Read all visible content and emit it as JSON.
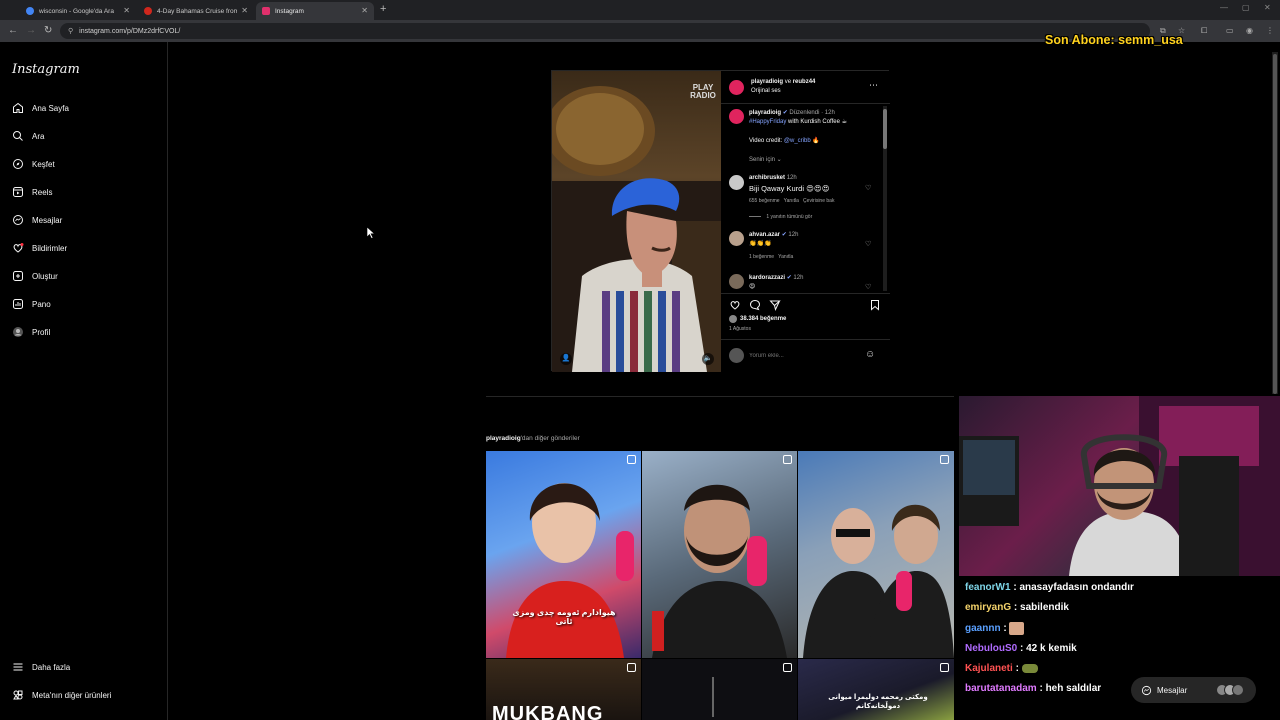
{
  "browser": {
    "tabs": [
      {
        "label": "wisconsin - Google'da Ara",
        "favicon_color": "#4285f4"
      },
      {
        "label": "4-Day Bahamas Cruise from Mi",
        "favicon_color": "#d0271d"
      },
      {
        "label": "Instagram",
        "favicon_color": "#e1306c"
      }
    ],
    "url": "instagram.com/p/DMz2drfCVOL/"
  },
  "overlay": {
    "subscriber": "Son Abone: semm_usa"
  },
  "sidebar": {
    "logo": "Instagram",
    "items": [
      {
        "label": "Ana Sayfa",
        "icon": "home-icon"
      },
      {
        "label": "Ara",
        "icon": "search-icon"
      },
      {
        "label": "Keşfet",
        "icon": "compass-icon"
      },
      {
        "label": "Reels",
        "icon": "reels-icon"
      },
      {
        "label": "Mesajlar",
        "icon": "messenger-icon"
      },
      {
        "label": "Bildirimler",
        "icon": "heart-icon"
      },
      {
        "label": "Oluştur",
        "icon": "plus-icon"
      },
      {
        "label": "Pano",
        "icon": "dashboard-icon"
      },
      {
        "label": "Profil",
        "icon": "profile-icon"
      }
    ],
    "more": "Daha fazla",
    "meta": "Meta'nın diğer ürünleri"
  },
  "post": {
    "video_brand": "PLAY RADIO",
    "header_user": "playradioig",
    "header_and": "ve",
    "header_user2": "reubz44",
    "audio": "Orijinal ses",
    "caption": {
      "user": "playradioig",
      "edited": "Düzenlendi",
      "time": "12h",
      "hashtag": "#HappyFriday",
      "text": "with Kurdish Coffee ☕",
      "credit_label": "Video credit:",
      "credit_user": "@w_cribb",
      "credit_emoji": "🔥",
      "for_you": "Senin için ⌄"
    },
    "comments": [
      {
        "user": "archibrusket",
        "time": "12h",
        "text": "Biji Qaway Kurdi 😍😍😍",
        "likes": "655 beğenme",
        "reply": "Yanıtla",
        "translate": "Çevirisine bak",
        "view_replies": "1 yanıtın tümünü gör"
      },
      {
        "user": "ahvan.azar",
        "time": "12h",
        "text": "👏👏👏",
        "likes": "1 beğenme",
        "reply": "Yanıtla"
      },
      {
        "user": "kardorazzazi",
        "time": "12h",
        "text": "😍"
      }
    ],
    "likes_count": "38.384 beğenme",
    "date": "1 Ağustos",
    "comment_placeholder": "Yorum ekle..."
  },
  "more_posts": {
    "user": "playradioig",
    "suffix": "'dan diğer gönderiler",
    "caption_1": "هيوادارم ئەومە چدی ومزی ئاتی",
    "caption_5": "MUKBANG",
    "caption_6": "ومکتی رمحمه دوليمرا میوانی دموڵخانەکانم"
  },
  "chat": [
    {
      "user": "feanorW1",
      "color": "#7fd6e8",
      "text": ": anasayfadasın ondandır"
    },
    {
      "user": "emiryanG",
      "color": "#f4d36b",
      "text": ": sabilendik"
    },
    {
      "user": "gaannn",
      "color": "#5aa0ff",
      "text": ":"
    },
    {
      "user": "NebulouS0",
      "color": "#b06bff",
      "text": ": 42 k kemik"
    },
    {
      "user": "Kajulaneti",
      "color": "#ff5252",
      "text": ":"
    },
    {
      "user": "barutatanadam",
      "color": "#e07bff",
      "text": ": heh saldılar"
    }
  ],
  "messages_bar": {
    "label": "Mesajlar"
  }
}
